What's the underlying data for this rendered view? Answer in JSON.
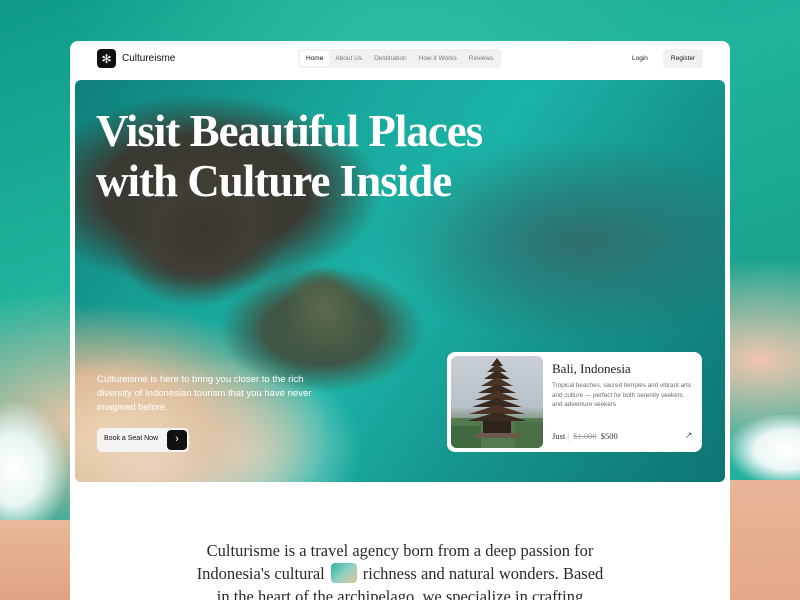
{
  "brand": {
    "name": "Cultureisme",
    "logo_icon": "flower-icon"
  },
  "nav": {
    "links": [
      "Home",
      "About Us",
      "Destination",
      "How it Works",
      "Reviews"
    ],
    "active": "Home",
    "login_label": "Login",
    "register_label": "Register"
  },
  "hero": {
    "title_line1": "Visit Beautiful Places",
    "title_line2": "with Culture Inside",
    "description": "Cultureisme is here to bring you closer to the rich diversity of Indonesian tourism that you have never imagined before.",
    "cta_label": "Book a Seat Now",
    "cta_icon": "chevron-right-icon"
  },
  "destination_card": {
    "title": "Bali, Indonesia",
    "description": "Tropical beaches, sacred temples and vibrant arts and culture — perfect for both serenity seekers and adventure seekers",
    "price_prefix": "Just",
    "old_price": "$1.000",
    "price": "$500",
    "arrow_icon": "arrow-up-right-icon"
  },
  "about": {
    "line1": "Culturisme is a travel agency born from a deep passion for",
    "line2_start": "Indonesia's cultural",
    "line2_end": "richness and natural wonders. Based",
    "line3": "in the heart of the archipelago, we specialize in crafting"
  },
  "colors": {
    "accent_dark": "#111111",
    "frame_bg": "#ffffff",
    "sea": "#1bb3a6"
  }
}
